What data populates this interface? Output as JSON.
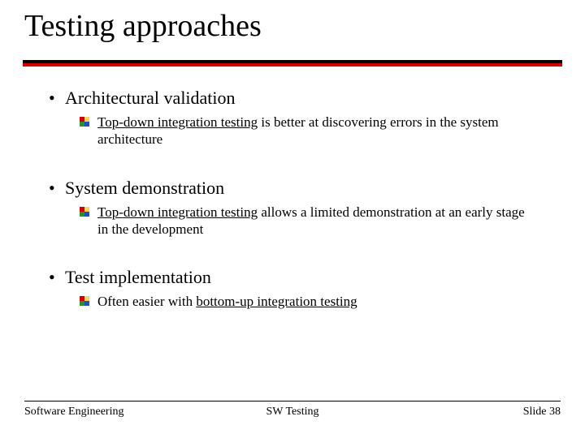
{
  "title": "Testing approaches",
  "bullets": [
    {
      "heading": "Architectural validation",
      "sub_prefix": "Top-down integration testing",
      "sub_rest": " is better at discovering errors in the system architecture"
    },
    {
      "heading": "System demonstration",
      "sub_prefix": "Top-down integration testing",
      "sub_rest": " allows a limited demonstration at an early stage in the development"
    },
    {
      "heading": "Test implementation",
      "sub_pretext": "Often easier with ",
      "sub_underlined_tail": "bottom-up integration testing"
    }
  ],
  "footer": {
    "left": "Software Engineering",
    "center": "SW Testing",
    "right": "Slide 38"
  },
  "icon_colors": {
    "tl": "#d00000",
    "tr": "#ffd060",
    "bl": "#2e8b2e",
    "br": "#2050c0"
  }
}
